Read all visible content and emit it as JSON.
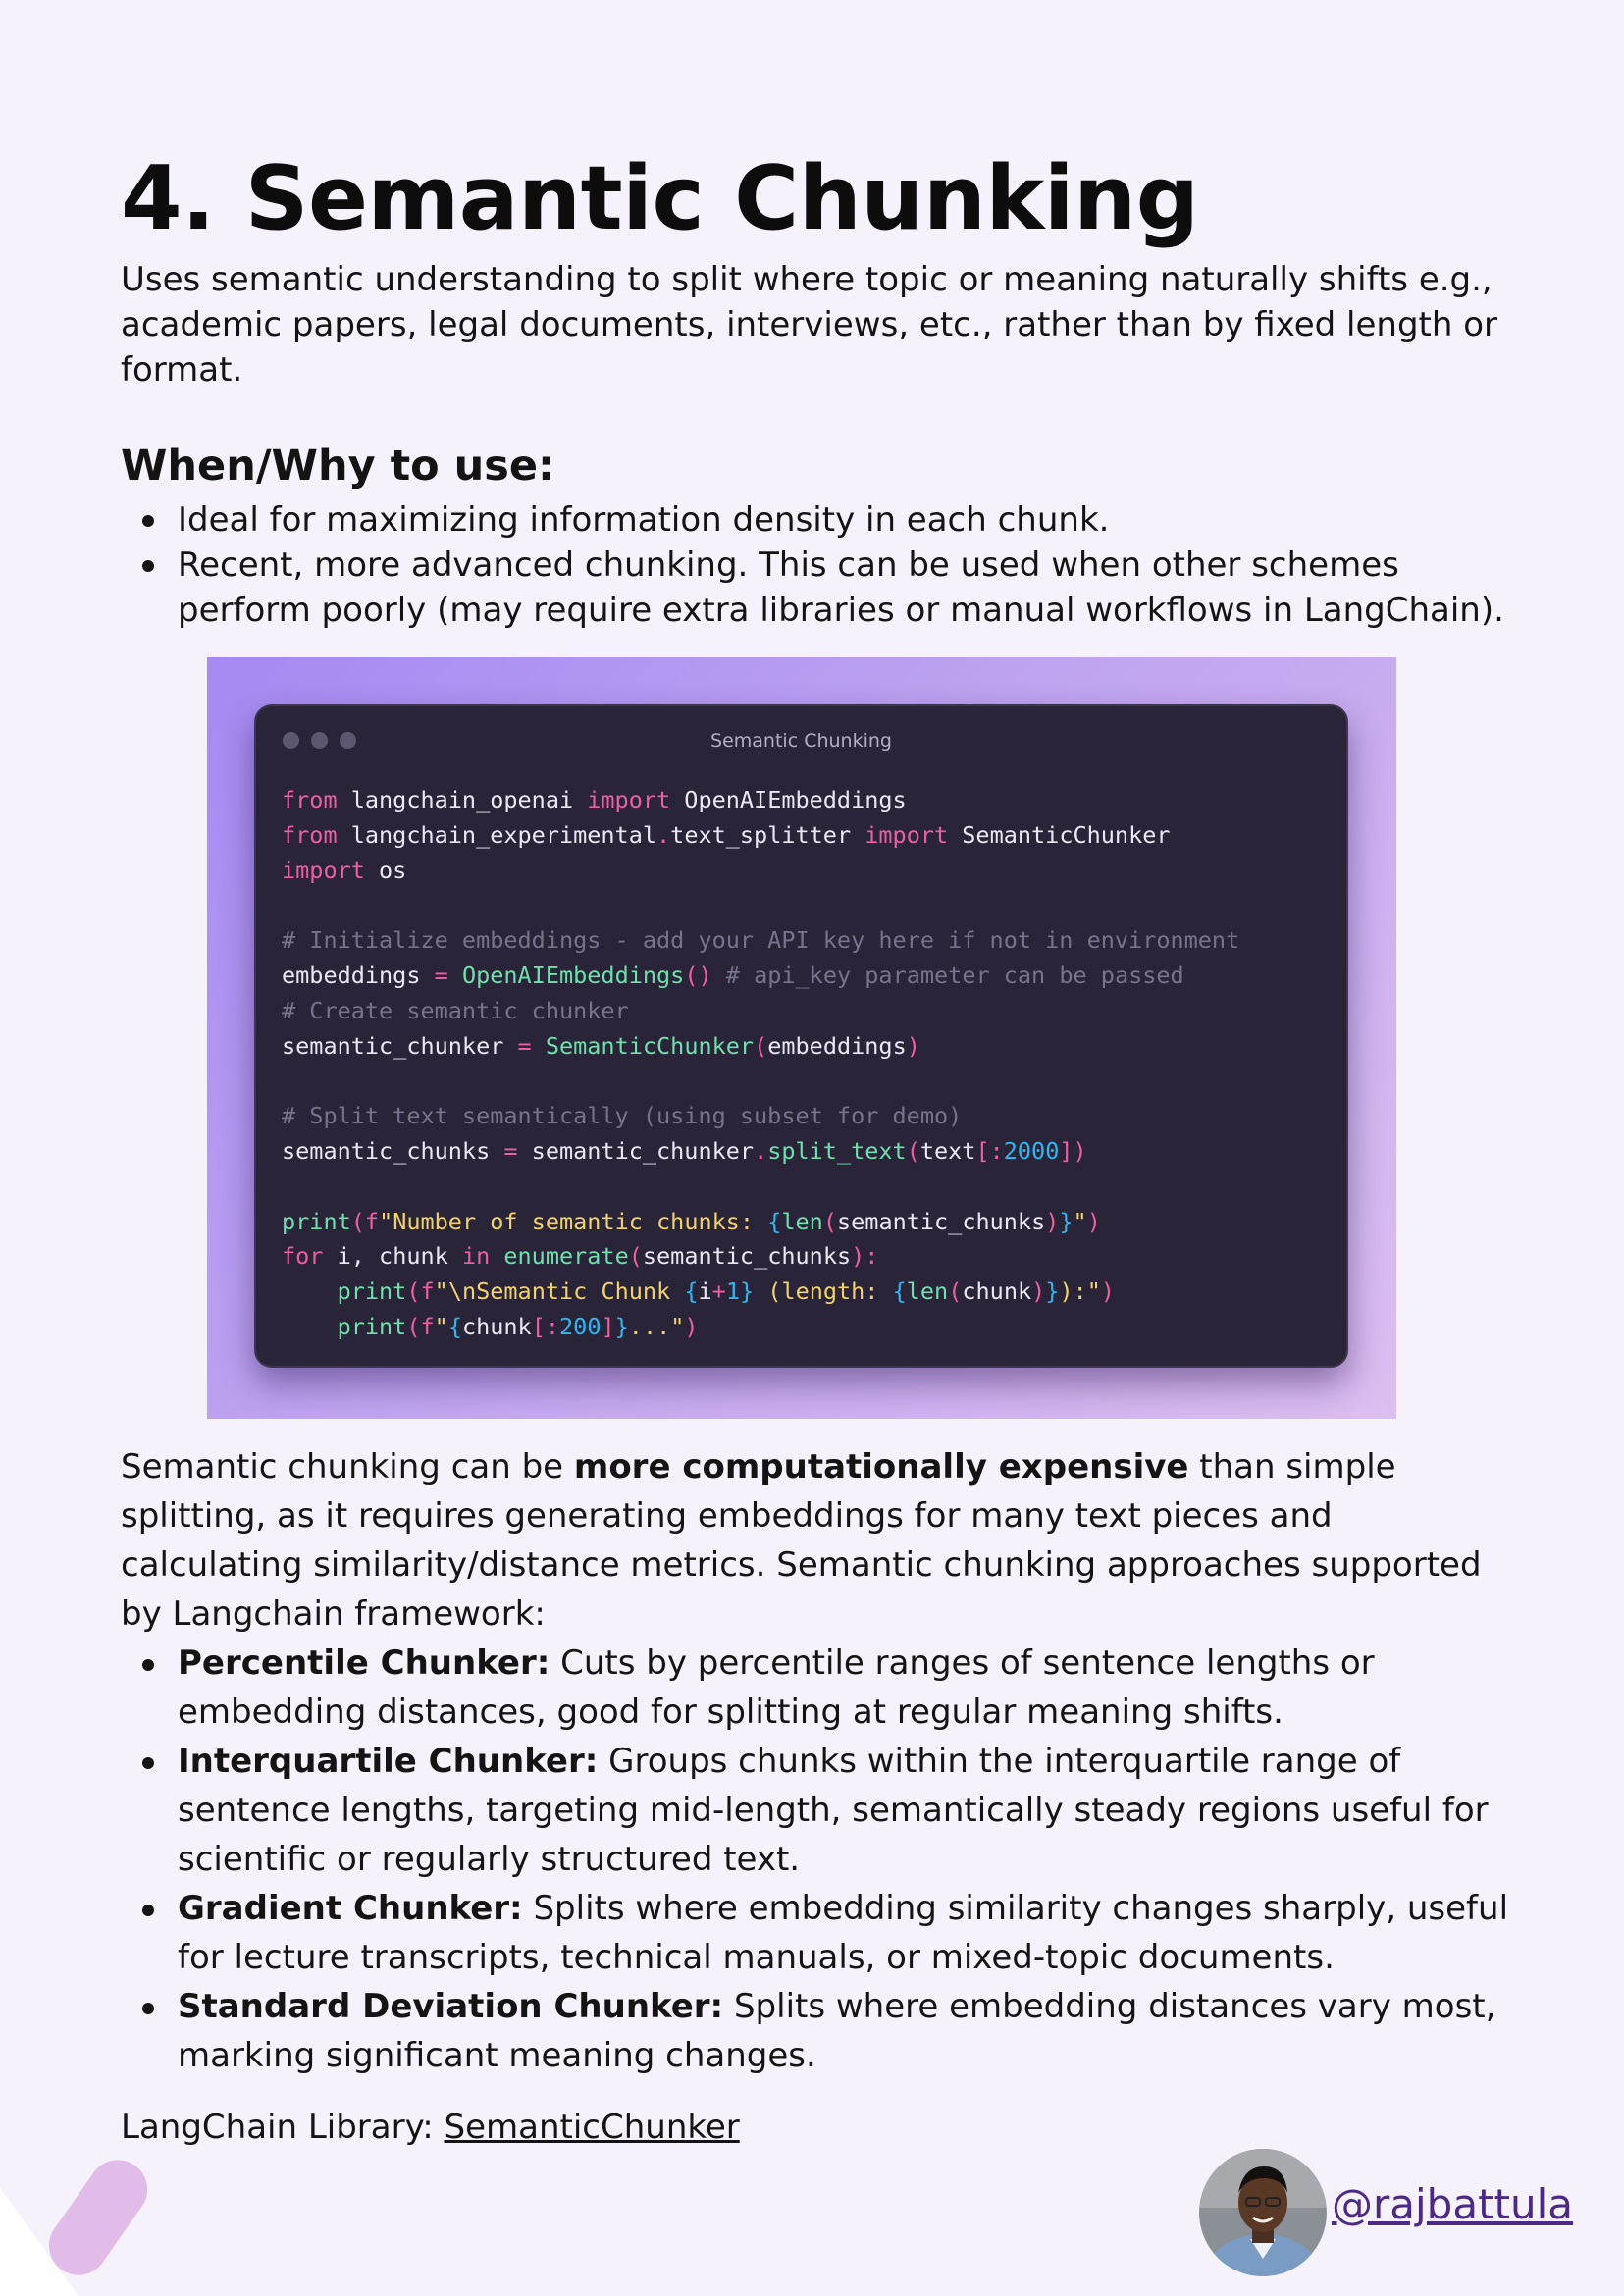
{
  "heading": "4. Semantic Chunking",
  "intro": "Uses semantic understanding to split where topic or meaning naturally shifts e.g., academic papers, legal documents, interviews, etc., rather than by fixed length or format.",
  "when_why": {
    "title": "When/Why to use:",
    "items": [
      "Ideal for maximizing information density in each chunk.",
      "Recent, more advanced chunking. This can be used when other schemes perform poorly (may require extra libraries or manual workflows in LangChain)."
    ]
  },
  "code_window": {
    "title": "Semantic Chunking",
    "lines": [
      "from langchain_openai import OpenAIEmbeddings",
      "from langchain_experimental.text_splitter import SemanticChunker",
      "import os",
      "",
      "# Initialize embeddings - add your API key here if not in environment",
      "embeddings = OpenAIEmbeddings() # api_key parameter can be passed",
      "# Create semantic chunker",
      "semantic_chunker = SemanticChunker(embeddings)",
      "",
      "# Split text semantically (using subset for demo)",
      "semantic_chunks = semantic_chunker.split_text(text[:2000])",
      "",
      "print(f\"Number of semantic chunks: {len(semantic_chunks)}\")",
      "for i, chunk in enumerate(semantic_chunks):",
      "    print(f\"\\nSemantic Chunk {i+1} (length: {len(chunk)}):\")",
      "    print(f\"{chunk[:200]}...\")"
    ]
  },
  "paragraph": {
    "before": "Semantic chunking can be ",
    "bold": "more computationally expensive",
    "after": " than simple splitting, as it requires generating embeddings for many text pieces and calculating similarity/distance metrics. Semantic chunking approaches supported by Langchain framework:"
  },
  "approaches": [
    {
      "name": "Percentile Chunker:",
      "desc": " Cuts by percentile ranges of sentence lengths or embedding distances, good for splitting at regular meaning shifts."
    },
    {
      "name": "Interquartile Chunker:",
      "desc": " Groups chunks within the interquartile range of sentence lengths, targeting mid-length, semantically steady regions useful for scientific or regularly structured text."
    },
    {
      "name": "Gradient Chunker:",
      "desc": " Splits where embedding similarity changes sharply, useful for lecture transcripts, technical manuals, or mixed-topic documents."
    },
    {
      "name": "Standard Deviation Chunker:",
      "desc": " Splits where embedding distances vary most, marking significant meaning changes."
    }
  ],
  "library": {
    "label": "LangChain Library: ",
    "link": "SemanticChunker"
  },
  "author": {
    "handle": "@rajbattula"
  },
  "colors": {
    "background": "#f6f2fc",
    "code_bg": "#2a2438",
    "keyword": "#ea5fa5",
    "function": "#6fe0ad",
    "comment": "#78728c",
    "number": "#2fb7f3",
    "handle": "#4b2a86"
  }
}
